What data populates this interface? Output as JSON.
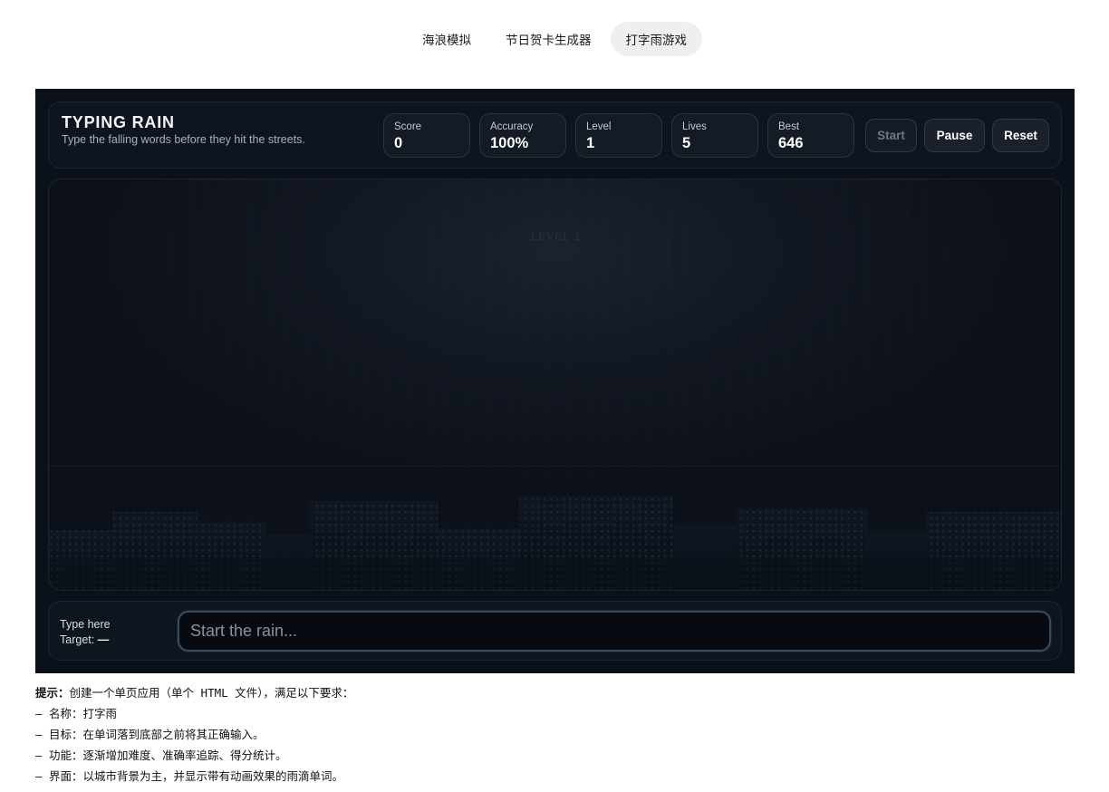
{
  "tabs": [
    {
      "label": "海浪模拟",
      "active": false
    },
    {
      "label": "节日贺卡生成器",
      "active": false
    },
    {
      "label": "打字雨游戏",
      "active": true
    }
  ],
  "game": {
    "title": "TYPING RAIN",
    "subtitle": "Type the falling words before they hit the streets.",
    "stats": {
      "score": {
        "label": "Score",
        "value": "0"
      },
      "accuracy": {
        "label": "Accuracy",
        "value": "100%"
      },
      "level": {
        "label": "Level",
        "value": "1"
      },
      "lives": {
        "label": "Lives",
        "value": "5"
      },
      "best": {
        "label": "Best",
        "value": "646"
      }
    },
    "buttons": {
      "start": "Start",
      "pause": "Pause",
      "reset": "Reset"
    },
    "stage": {
      "level_tag": "LEVEL 1"
    },
    "input": {
      "type_here": "Type here",
      "target_label": "Target:",
      "target_value": "—",
      "placeholder": "Start the rain..."
    }
  },
  "notes": {
    "prompt_label": "提示：",
    "prompt_text": "创建一个单页应用（单个 HTML 文件），满足以下要求：",
    "items": [
      "– 名称：打字雨",
      "– 目标：在单词落到底部之前将其正确输入。",
      "– 功能：逐渐增加难度、准确率追踪、得分统计。",
      "– 界面：以城市背景为主，并显示带有动画效果的雨滴单词。"
    ]
  },
  "colors": {
    "app_bg": "#0b111a",
    "panel_bg": "#0f151f",
    "accent_border": "#3a4b5e",
    "city": "#121b28",
    "window": "#1a2636"
  }
}
